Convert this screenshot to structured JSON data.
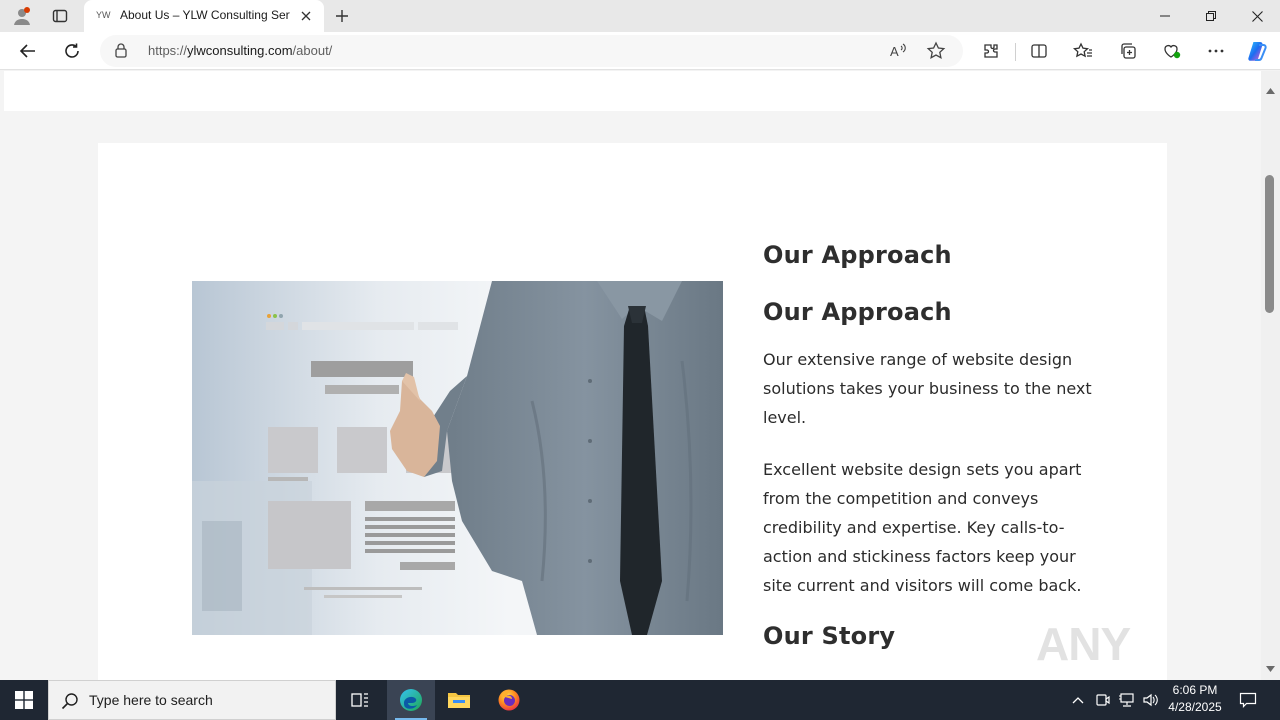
{
  "tab": {
    "favicon_text": "YW",
    "title": "About Us – YLW Consulting Services"
  },
  "address_bar": {
    "url_prefix": "https://",
    "url_domain": "ylwconsulting.com",
    "url_path": "/about/"
  },
  "page": {
    "headings": {
      "approach_1": "Our Approach",
      "approach_2": "Our Approach",
      "story": "Our Story"
    },
    "paragraphs": {
      "p1": "Our extensive range of website design solutions takes your business to the next level.",
      "p2": "Excellent website design sets you apart from the competition and conveys credibility and expertise. Key calls-to-action and stickiness factors keep your site current and visitors will come back."
    },
    "watermark": "ANY RUN"
  },
  "taskbar": {
    "search_placeholder": "Type here to search",
    "time": "6:06 PM",
    "date": "4/28/2025"
  },
  "colors": {
    "accent": "#0078d4",
    "taskbar_bg": "#1f2733",
    "heading": "#2e2e2e"
  }
}
